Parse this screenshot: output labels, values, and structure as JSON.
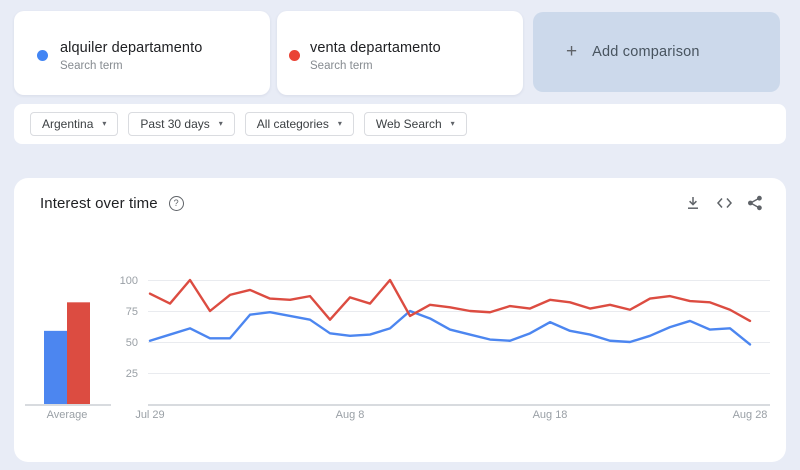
{
  "terms": [
    {
      "label": "alquiler departamento",
      "sublabel": "Search term",
      "color": "#4285f4"
    },
    {
      "label": "venta departamento",
      "sublabel": "Search term",
      "color": "#ea4335"
    }
  ],
  "add_comparison": {
    "label": "Add comparison"
  },
  "filters": [
    {
      "label": "Argentina"
    },
    {
      "label": "Past 30 days"
    },
    {
      "label": "All categories"
    },
    {
      "label": "Web Search"
    }
  ],
  "chart_panel": {
    "title": "Interest over time",
    "action_icons": [
      "download-icon",
      "embed-code-icon",
      "share-icon"
    ]
  },
  "icons": {
    "help": "?",
    "caret": "▾",
    "plus": "+"
  },
  "colors": {
    "page_background": "#e8ecf6",
    "card_background": "#ffffff",
    "add_card_background": "#ccd9eb",
    "axis_text": "#9aa0a6",
    "gridline": "#e9ebef",
    "blue_line": "#4c86f0",
    "red_line": "#dc4c41"
  },
  "chart_data": {
    "type": "line",
    "title": "Interest over time",
    "xlabel": "",
    "ylabel": "",
    "ylim": [
      0,
      100
    ],
    "y_ticks": [
      25,
      50,
      75,
      100
    ],
    "x_ticks": [
      "Jul 29",
      "Aug 8",
      "Aug 18",
      "Aug 28"
    ],
    "x_tick_indices": [
      0,
      10,
      20,
      30
    ],
    "grid": true,
    "legend_position": "none",
    "series": [
      {
        "name": "alquiler departamento",
        "color": "#4c86f0",
        "values": [
          51,
          56,
          61,
          53,
          53,
          72,
          74,
          71,
          68,
          57,
          55,
          56,
          61,
          75,
          69,
          60,
          56,
          52,
          51,
          57,
          66,
          59,
          56,
          51,
          50,
          55,
          62,
          67,
          60,
          61,
          48
        ]
      },
      {
        "name": "venta departamento",
        "color": "#dc4c41",
        "values": [
          89,
          81,
          100,
          75,
          88,
          92,
          85,
          84,
          87,
          68,
          86,
          81,
          100,
          71,
          80,
          78,
          75,
          74,
          79,
          77,
          84,
          82,
          77,
          80,
          76,
          85,
          87,
          83,
          82,
          76,
          67
        ]
      }
    ],
    "averages": {
      "label": "Average",
      "values": [
        {
          "name": "alquiler departamento",
          "value": 59
        },
        {
          "name": "venta departamento",
          "value": 82
        }
      ]
    }
  }
}
